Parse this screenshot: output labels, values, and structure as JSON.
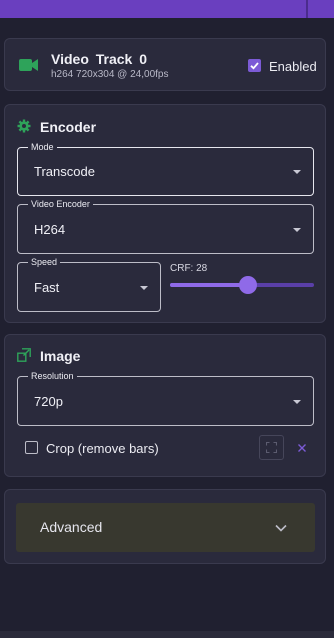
{
  "video_track": {
    "title": "Video Track 0",
    "subtitle": "h264 720x304 @ 24,00fps",
    "enabled_label": "Enabled",
    "enabled": true,
    "icon": "video-camera-icon"
  },
  "encoder": {
    "title": "Encoder",
    "icon": "gear-icon",
    "mode": {
      "label": "Mode",
      "value": "Transcode"
    },
    "video_encoder": {
      "label": "Video Encoder",
      "value": "H264"
    },
    "speed": {
      "label": "Speed",
      "value": "Fast"
    },
    "crf": {
      "label": "CRF: 28",
      "value": 28,
      "fraction": 0.54
    }
  },
  "image": {
    "title": "Image",
    "icon": "resize-icon",
    "resolution": {
      "label": "Resolution",
      "value": "720p"
    },
    "crop_label": "Crop (remove bars)",
    "crop_checked": false
  },
  "advanced": {
    "label": "Advanced"
  },
  "colors": {
    "accent": "#7c5bd6",
    "green_icon": "#2ea35a",
    "card_bg": "#2a2a3c",
    "page_bg": "#202030"
  }
}
